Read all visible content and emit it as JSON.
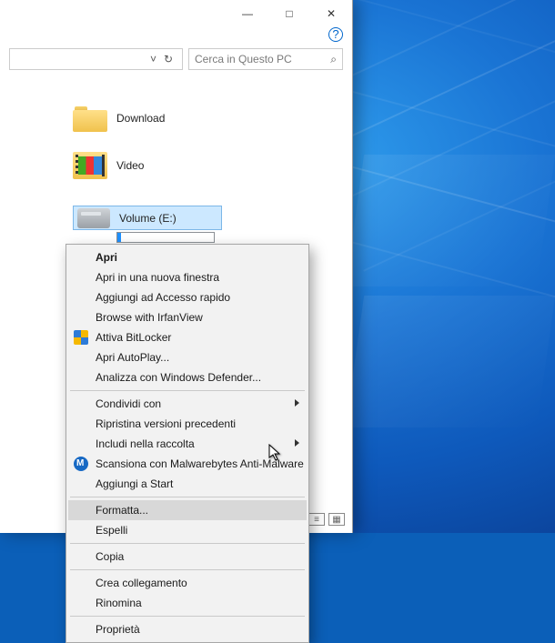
{
  "window_controls": {
    "minimize": "—",
    "maximize": "□",
    "close": "✕"
  },
  "help_icon": "?",
  "addressbar": {
    "dropdown_glyph": "˅",
    "refresh_glyph": "↻"
  },
  "search": {
    "placeholder": "Cerca in Questo PC",
    "icon_glyph": "⌕"
  },
  "folders": [
    {
      "label": "Download"
    },
    {
      "label": "Video"
    }
  ],
  "drive": {
    "label": "Volume (E:)"
  },
  "context_menu": {
    "items": [
      {
        "label": "Apri",
        "bold": true
      },
      {
        "label": "Apri in una nuova finestra"
      },
      {
        "label": "Aggiungi ad Accesso rapido"
      },
      {
        "label": "Browse with IrfanView"
      },
      {
        "label": "Attiva BitLocker",
        "icon": "shield"
      },
      {
        "label": "Apri AutoPlay..."
      },
      {
        "label": "Analizza con Windows Defender..."
      },
      {
        "sep": true
      },
      {
        "label": "Condividi con",
        "submenu": true
      },
      {
        "label": "Ripristina versioni precedenti"
      },
      {
        "label": "Includi nella raccolta",
        "submenu": true
      },
      {
        "label": "Scansiona con Malwarebytes Anti-Malware",
        "icon": "mbyte"
      },
      {
        "label": "Aggiungi a Start"
      },
      {
        "sep": true
      },
      {
        "label": "Formatta...",
        "hover": true
      },
      {
        "label": "Espelli"
      },
      {
        "sep": true
      },
      {
        "label": "Copia"
      },
      {
        "sep": true
      },
      {
        "label": "Crea collegamento"
      },
      {
        "label": "Rinomina"
      },
      {
        "sep": true
      },
      {
        "label": "Proprietà"
      }
    ]
  }
}
